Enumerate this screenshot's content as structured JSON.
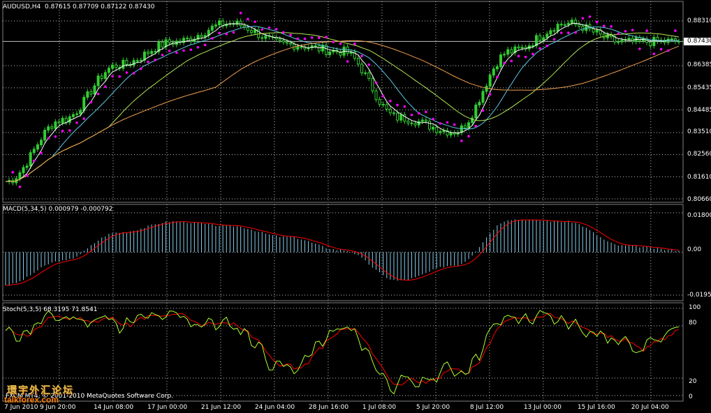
{
  "main_pane": {
    "header": "AUDUSD,H4  0.87615 0.87709 0.87122 0.87430",
    "price_labels": [
      "0.88310",
      "0.87430",
      "0.86385",
      "0.85435",
      "0.84485",
      "0.83510",
      "0.82560",
      "0.81610",
      "0.80660"
    ],
    "current_price": "0.87430"
  },
  "macd_pane": {
    "header": "MACD(5,34,5) 0.000979 -0.000792",
    "axis_labels": [
      "0.018000",
      "0.00",
      "-0.019584"
    ]
  },
  "stoch_pane": {
    "header": "Stoch(5,3,5) 68.3195 71.8541",
    "axis_labels": [
      "100",
      "80",
      "20",
      "0"
    ]
  },
  "time_axis": [
    "7 Jun 2010",
    "9 Jun 20:00",
    "14 Jun 08:00",
    "17 Jun 00:00",
    "21 Jun 12:00",
    "24 Jun 04:00",
    "28 Jun 16:00",
    "1 Jul 08:00",
    "5 Jul 20:00",
    "8 Jul 12:00",
    "13 Jul 00:00",
    "15 Jul 16:00",
    "20 Jul 04:00"
  ],
  "copyright": "FXCM MT4, © 2001-2010 MetaQuotes Software Corp.",
  "watermark": {
    "chinese": "環宇外汇论坛",
    "english": "talkforex.com"
  },
  "colors": {
    "background": "#000000",
    "grid": "#c0c0c0",
    "bull_candle": "#32cd32",
    "parabolic_sar": "#ff00ff",
    "ma_fast": "#ffffff",
    "ma_cyan": "#5fc8e6",
    "ma_green": "#b4e650",
    "ma_orange": "#f0a050",
    "macd_histogram": "#87ceeb",
    "macd_signal": "#ff0000",
    "stoch_main": "#adff2f",
    "stoch_signal": "#ff0000"
  },
  "chart_data": {
    "type": "line",
    "symbol": "AUDUSD",
    "timeframe": "H4",
    "ohlc_last": {
      "open": 0.87615,
      "high": 0.87709,
      "low": 0.87122,
      "close": 0.8743
    },
    "ylim": [
      0.8066,
      0.8831
    ],
    "x": [
      "7 Jun 2010",
      "9 Jun 20:00",
      "14 Jun 08:00",
      "17 Jun 00:00",
      "21 Jun 12:00",
      "24 Jun 04:00",
      "28 Jun 16:00",
      "1 Jul 08:00",
      "5 Jul 20:00",
      "8 Jul 12:00",
      "13 Jul 00:00",
      "15 Jul 16:00",
      "20 Jul 04:00"
    ],
    "series": [
      {
        "name": "",
        "values": [
          0.814,
          0.8405,
          0.864,
          0.874,
          0.882,
          0.873,
          0.87,
          0.8415,
          0.8355,
          0.87,
          0.882,
          0.874,
          0.8743
        ]
      }
    ],
    "macd": {
      "params": "5,34,5",
      "main": 0.000979,
      "signal": -0.000792,
      "values": [
        -0.015,
        -0.004,
        0.009,
        0.014,
        0.012,
        0.007,
        0.001,
        -0.013,
        -0.006,
        0.015,
        0.014,
        0.003,
        0.0009
      ],
      "ylim": [
        -0.019584,
        0.018
      ]
    },
    "stochastic": {
      "params": "5,3,5",
      "main": 68.3195,
      "signal": 71.8541,
      "values": [
        70,
        90,
        85,
        88,
        80,
        30,
        75,
        10,
        30,
        90,
        85,
        60,
        68
      ],
      "ylim": [
        0,
        100
      ]
    },
    "grid": true
  }
}
